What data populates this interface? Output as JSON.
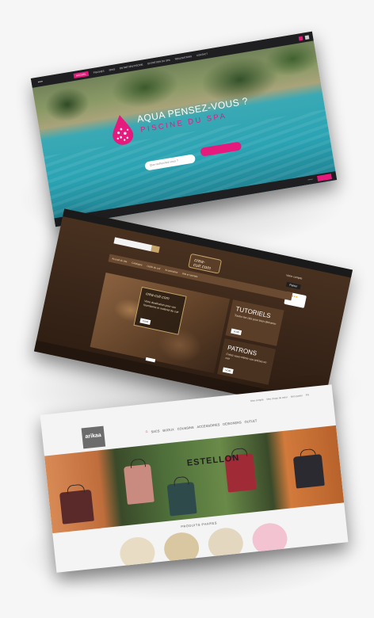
{
  "aqua": {
    "nav_items": [
      "ACCUEIL",
      "PISCINES",
      "SPAS",
      "ENTRETIEN PISCINE",
      "ENTRETIEN DU SPA",
      "REALISATIONS",
      "CONTACT"
    ],
    "title": "AQUA PENSEZ-VOUS ?",
    "subtitle": "PISCINE DU SPA",
    "input_placeholder": "Que recherchez-vous ?",
    "colors": {
      "accent": "#e6197d",
      "nav_bg": "#1f1f22"
    }
  },
  "cuir": {
    "logo": "crea-cuir.com",
    "account_label": "Votre compte",
    "cart_label": "Panier",
    "menu_items": [
      "Accueil du site",
      "Catalogue",
      "Outils du cuir",
      "Accessoires",
      "Kits et tutoriels"
    ],
    "hero_logo": "crea-cuir.com",
    "hero_text": "Votre destination pour vos fournitures et matériel du cuir",
    "hero_btn": "VOIR",
    "tutoriels_title": "TUTORIELS",
    "tutoriels_text": "Toutes les clés pour bien démarrer",
    "tutoriels_btn": "VOIR",
    "patrons_title": "PATRONS",
    "patrons_text": "Créez vous-même vos articles en cuir",
    "patrons_btn": "VOIR",
    "colors": {
      "bg": "#3b271a",
      "accent": "#c7a56b"
    }
  },
  "arikaa": {
    "logo": "arikaa",
    "top_links": [
      "Mon compte",
      "Mes coups de cœur",
      "Mon panier",
      "FR"
    ],
    "menu_items": [
      "SACS",
      "BIJOUX",
      "COUSSINS",
      "ACCESSOIRES",
      "DESIGNERS",
      "OUTLET"
    ],
    "banner_title": "ESTELLON",
    "products_title": "PRODUITS PHARES",
    "colors": {
      "accent": "#e6197d",
      "logo_bg": "#6c6c6c"
    }
  }
}
